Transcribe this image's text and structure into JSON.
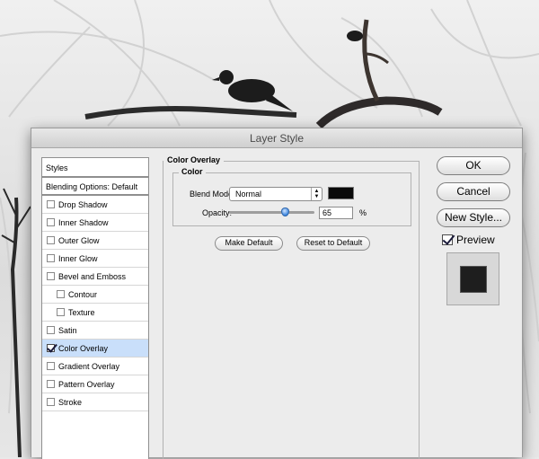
{
  "dialog": {
    "title": "Layer Style"
  },
  "styles_list": {
    "header": "Styles",
    "blending": "Blending Options: Default",
    "items": [
      {
        "label": "Drop Shadow",
        "checked": false,
        "indent": false,
        "selected": false
      },
      {
        "label": "Inner Shadow",
        "checked": false,
        "indent": false,
        "selected": false
      },
      {
        "label": "Outer Glow",
        "checked": false,
        "indent": false,
        "selected": false
      },
      {
        "label": "Inner Glow",
        "checked": false,
        "indent": false,
        "selected": false
      },
      {
        "label": "Bevel and Emboss",
        "checked": false,
        "indent": false,
        "selected": false
      },
      {
        "label": "Contour",
        "checked": false,
        "indent": true,
        "selected": false
      },
      {
        "label": "Texture",
        "checked": false,
        "indent": true,
        "selected": false
      },
      {
        "label": "Satin",
        "checked": false,
        "indent": false,
        "selected": false
      },
      {
        "label": "Color Overlay",
        "checked": true,
        "indent": false,
        "selected": true
      },
      {
        "label": "Gradient Overlay",
        "checked": false,
        "indent": false,
        "selected": false
      },
      {
        "label": "Pattern Overlay",
        "checked": false,
        "indent": false,
        "selected": false
      },
      {
        "label": "Stroke",
        "checked": false,
        "indent": false,
        "selected": false
      }
    ]
  },
  "panel": {
    "title": "Color Overlay",
    "group_title": "Color",
    "blend_mode_label": "Blend Mode:",
    "blend_mode_value": "Normal",
    "overlay_color": "#0a0a0a",
    "opacity_label": "Opacity:",
    "opacity_value": "65",
    "opacity_unit": "%",
    "opacity_fraction": 0.65,
    "make_default": "Make Default",
    "reset_default": "Reset to Default"
  },
  "buttons": {
    "ok": "OK",
    "cancel": "Cancel",
    "new_style": "New Style...",
    "preview_label": "Preview",
    "preview_checked": true
  },
  "colors": {
    "selected_row": "#c9dffa",
    "accent": "#3c86df"
  }
}
